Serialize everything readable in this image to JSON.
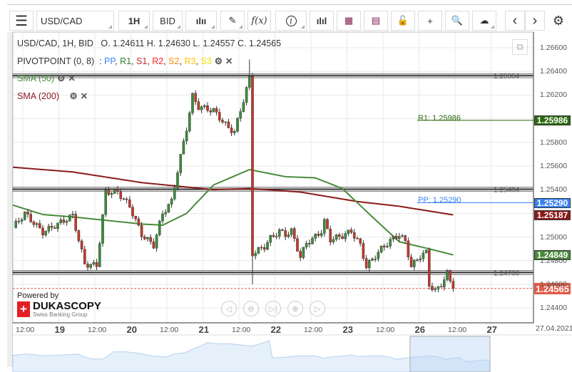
{
  "toolbar": {
    "menu_icon": "hamburger-icon",
    "instrument": "USD/CAD",
    "period": "1H",
    "side": "BID",
    "chart_type_icon": "candlestick-icon",
    "draw_icon": "pencil-icon",
    "indicator_label": "f(x)",
    "info_icon": "info-icon",
    "volume_icon": "bar-chart-icon",
    "calendar_icon": "calendar-icon",
    "news_icon": "news-icon",
    "lock_icon": "unlock-icon",
    "crosshair_icon": "crosshair-icon",
    "zoom_icon": "zoom-chart-icon",
    "upload_icon": "cloud-upload-icon",
    "prev": "‹",
    "next": "›",
    "settings_icon": "gear-icon"
  },
  "info": {
    "header": "USD/CAD, 1H, BID",
    "ohlc": "O. 1.24611 H. 1.24630 L. 1.24557 C. 1.24565"
  },
  "pivot": {
    "label": "PIVOTPOINT (0, 8)",
    "sep": ":",
    "items": [
      {
        "t": "PP",
        "c": "#3b82f6"
      },
      {
        "t": "R1",
        "c": "#2e7d32"
      },
      {
        "t": "S1",
        "c": "#c62828"
      },
      {
        "t": "R2",
        "c": "#ff2020"
      },
      {
        "t": "S2",
        "c": "#ff8c00"
      },
      {
        "t": "R3",
        "c": "#ffc000"
      },
      {
        "t": "S3",
        "c": "#f0e000"
      }
    ]
  },
  "sma50": {
    "label": "SMA (50)",
    "color": "#4a8a3a",
    "value": "1.24849"
  },
  "sma200": {
    "label": "SMA (200)",
    "color": "#8b1a1a",
    "value": "1.25187"
  },
  "levels": {
    "r1": {
      "label": "R1: 1.25986",
      "value": "1.25986",
      "color": "#2d6a0f"
    },
    "pp": {
      "label": "PP: 1.25290",
      "value": "1.25290",
      "color": "#3b82f6"
    },
    "current": {
      "value": "1.24565",
      "color": "#e05a47"
    },
    "hlines": [
      "1.26364",
      "1.25404",
      "1.24700"
    ]
  },
  "price_axis": [
    "1.26600",
    "1.26400",
    "1.26200",
    "1.25800",
    "1.25600",
    "1.25400",
    "1.25000",
    "1.24800",
    "1.24600",
    "1.24400"
  ],
  "time_axis": [
    {
      "t": "12:00",
      "d": false
    },
    {
      "t": "19",
      "d": true
    },
    {
      "t": "12:00",
      "d": false
    },
    {
      "t": "20",
      "d": true
    },
    {
      "t": "12:00",
      "d": false
    },
    {
      "t": "21",
      "d": true
    },
    {
      "t": "12:00",
      "d": false
    },
    {
      "t": "22",
      "d": true
    },
    {
      "t": "12:00",
      "d": false
    },
    {
      "t": "23",
      "d": true
    },
    {
      "t": "12:00",
      "d": false
    },
    {
      "t": "26",
      "d": true
    },
    {
      "t": "12:00",
      "d": false
    },
    {
      "t": "27",
      "d": true
    }
  ],
  "date_label": "27.04.2021",
  "branding": {
    "powered": "Powered by",
    "name": "DUKASCOPY",
    "sub": "Swiss Banking Group"
  },
  "nav": [
    "◁",
    "⊖",
    "▷|",
    "⊕",
    "▷"
  ],
  "chart_data": {
    "type": "candlestick",
    "ylim": [
      1.2432,
      1.2672
    ],
    "close_path": [
      [
        0,
        1.2508
      ],
      [
        4,
        1.252
      ],
      [
        10,
        1.2504
      ],
      [
        20,
        1.2518
      ],
      [
        24,
        1.2477
      ],
      [
        28,
        1.2476
      ],
      [
        31,
        1.2538
      ],
      [
        35,
        1.2538
      ],
      [
        39,
        1.2526
      ],
      [
        43,
        1.2502
      ],
      [
        47,
        1.2493
      ],
      [
        50,
        1.252
      ],
      [
        53,
        1.253
      ],
      [
        55,
        1.2556
      ],
      [
        58,
        1.2592
      ],
      [
        60,
        1.2619
      ],
      [
        62,
        1.261
      ],
      [
        67,
        1.2607
      ],
      [
        72,
        1.2592
      ],
      [
        74,
        1.2589
      ],
      [
        77,
        1.2616
      ],
      [
        79,
        1.2634
      ],
      [
        80,
        1.2486
      ],
      [
        82,
        1.2489
      ],
      [
        84,
        1.2492
      ],
      [
        86,
        1.2499
      ],
      [
        89,
        1.2505
      ],
      [
        91,
        1.2502
      ],
      [
        93,
        1.2505
      ],
      [
        96,
        1.2483
      ],
      [
        98,
        1.2495
      ],
      [
        100,
        1.2498
      ],
      [
        103,
        1.2505
      ],
      [
        104,
        1.2513
      ],
      [
        106,
        1.2498
      ],
      [
        110,
        1.2501
      ],
      [
        113,
        1.2505
      ],
      [
        116,
        1.2493
      ],
      [
        118,
        1.2475
      ],
      [
        120,
        1.2481
      ],
      [
        123,
        1.249
      ],
      [
        127,
        1.2499
      ],
      [
        129,
        1.2502
      ],
      [
        131,
        1.2496
      ],
      [
        133,
        1.2475
      ],
      [
        136,
        1.2484
      ],
      [
        138,
        1.2487
      ],
      [
        139,
        1.246
      ],
      [
        141,
        1.2454
      ],
      [
        143,
        1.246
      ],
      [
        145,
        1.2469
      ],
      [
        147,
        1.24565
      ]
    ],
    "spike": {
      "hour": 79,
      "high": 1.265,
      "low": 1.246
    },
    "sma50": [
      [
        0,
        1.2527
      ],
      [
        10,
        1.2519
      ],
      [
        20,
        1.2517
      ],
      [
        43,
        1.2511
      ],
      [
        50,
        1.251
      ],
      [
        58,
        1.252
      ],
      [
        67,
        1.2544
      ],
      [
        79,
        1.2557
      ],
      [
        91,
        1.2551
      ],
      [
        101,
        1.255
      ],
      [
        110,
        1.2541
      ],
      [
        120,
        1.2517
      ],
      [
        129,
        1.2496
      ],
      [
        139,
        1.249
      ],
      [
        147,
        1.24849
      ]
    ],
    "sma200": [
      [
        0,
        1.2559
      ],
      [
        20,
        1.2555
      ],
      [
        43,
        1.2546
      ],
      [
        67,
        1.254
      ],
      [
        79,
        1.2541
      ],
      [
        96,
        1.2538
      ],
      [
        115,
        1.253
      ],
      [
        129,
        1.2526
      ],
      [
        147,
        1.25187
      ]
    ]
  }
}
